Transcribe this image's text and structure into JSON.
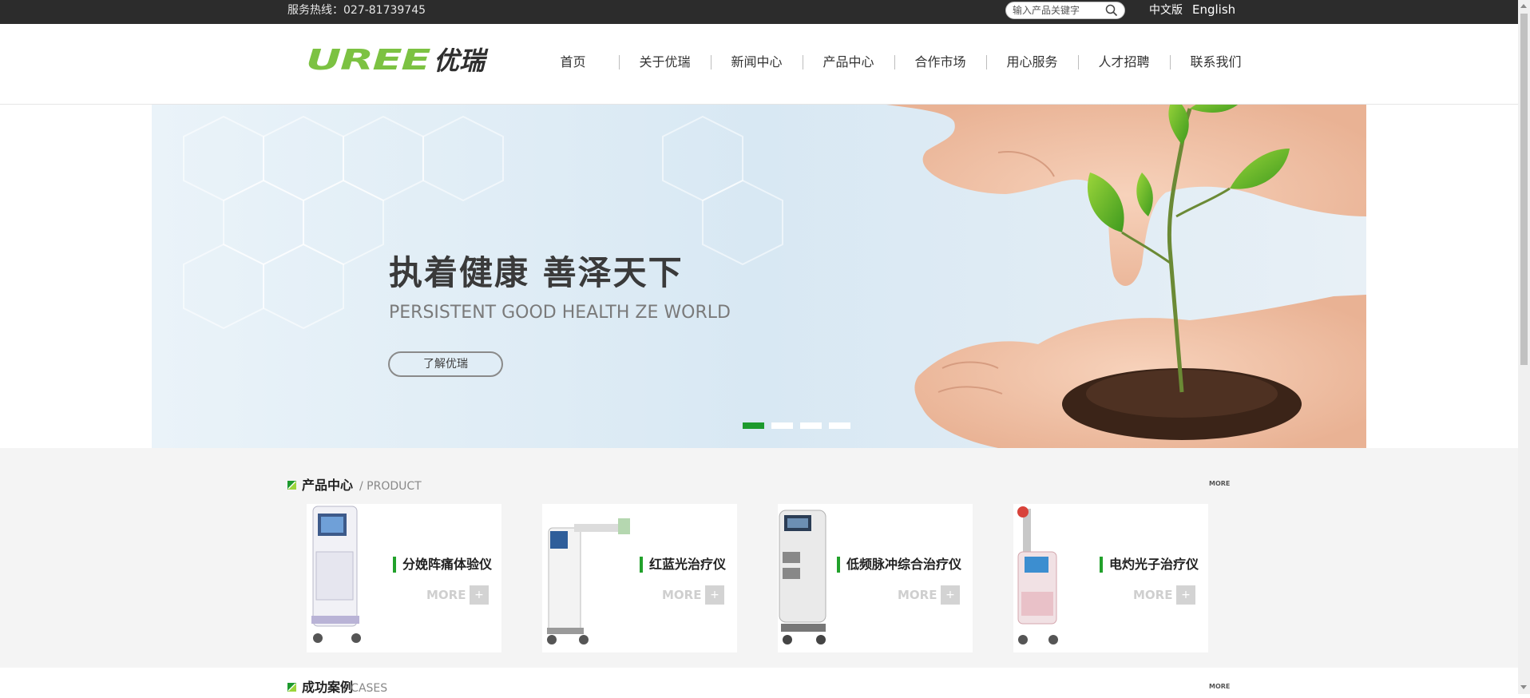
{
  "topbar": {
    "hotline": "服务热线：027-81739745",
    "search_placeholder": "输入产品关键字",
    "lang_cn": "中文版",
    "lang_en": "English"
  },
  "logo": {
    "text_en": "UREE",
    "text_cn": "优瑞"
  },
  "nav": [
    {
      "label": "首页"
    },
    {
      "label": "关于优瑞"
    },
    {
      "label": "新闻中心"
    },
    {
      "label": "产品中心"
    },
    {
      "label": "合作市场"
    },
    {
      "label": "用心服务"
    },
    {
      "label": "人才招聘"
    },
    {
      "label": "联系我们"
    }
  ],
  "banner": {
    "slogan_cn": "执着健康  善泽天下",
    "slogan_en": "PERSISTENT GOOD HEALTH ZE WORLD",
    "button": "了解优瑞",
    "slides": 4,
    "active_slide": 1
  },
  "product_section": {
    "title": "产品中心",
    "subtitle": "/ PRODUCT",
    "more": "MORE",
    "items": [
      {
        "name": "分娩阵痛体验仪",
        "more": "MORE",
        "plus": "+"
      },
      {
        "name": "红蓝光治疗仪",
        "more": "MORE",
        "plus": "+"
      },
      {
        "name": "低频脉冲综合治疗仪",
        "more": "MORE",
        "plus": "+"
      },
      {
        "name": "电灼光子治疗仪",
        "more": "MORE",
        "plus": "+"
      }
    ]
  },
  "cases_section": {
    "title": "成功案例",
    "subtitle": "/ CASES",
    "more": "MORE"
  },
  "colors": {
    "topbar": "#2c2c2c",
    "accent_green": "#22a12b",
    "logo_green": "#7cc242",
    "section_bg": "#f4f4f4"
  }
}
